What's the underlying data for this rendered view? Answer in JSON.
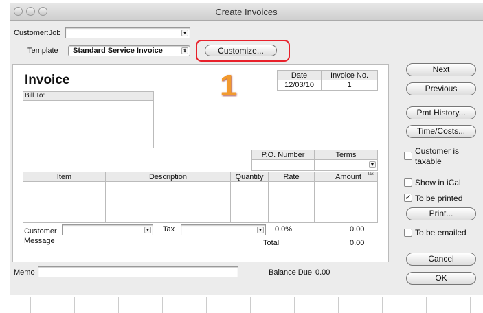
{
  "window": {
    "title": "Create Invoices"
  },
  "header": {
    "customer_job_label": "Customer:Job",
    "customer_job_value": "",
    "template_label": "Template",
    "template_value": "Standard Service Invoice",
    "customize_label": "Customize...",
    "annotation": "1"
  },
  "invoice": {
    "heading": "Invoice",
    "date_label": "Date",
    "date_value": "12/03/10",
    "invoice_no_label": "Invoice No.",
    "invoice_no_value": "1",
    "bill_to_label": "Bill To:",
    "po_label": "P.O. Number",
    "terms_label": "Terms",
    "columns": [
      "Item",
      "Description",
      "Quantity",
      "Rate",
      "Amount",
      "Tax"
    ],
    "customer_message_label_1": "Customer",
    "customer_message_label_2": "Message",
    "tax_label": "Tax",
    "tax_rate": "0.0%",
    "tax_amount": "0.00",
    "total_label": "Total",
    "total_value": "0.00"
  },
  "footer": {
    "memo_label": "Memo",
    "balance_due_label": "Balance Due",
    "balance_due_value": "0.00"
  },
  "side": {
    "next": "Next",
    "previous": "Previous",
    "pmt_history": "Pmt History...",
    "time_costs": "Time/Costs...",
    "customer_taxable": "Customer is",
    "customer_taxable_2": "taxable",
    "show_ical": "Show in iCal",
    "to_be_printed": "To be printed",
    "print": "Print...",
    "to_be_emailed": "To be emailed",
    "cancel": "Cancel",
    "ok": "OK",
    "checked_mark": "✓"
  },
  "colors": {
    "highlight": "#e8202a",
    "annotation": "#f29a2e"
  }
}
